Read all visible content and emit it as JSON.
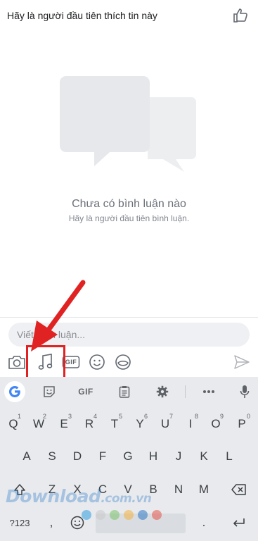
{
  "header": {
    "text": "Hãy là người đầu tiên thích tin này"
  },
  "empty_state": {
    "title": "Chưa có bình luận nào",
    "subtitle": "Hãy là người đầu tiên bình luận."
  },
  "comment": {
    "placeholder": "Viết bình luận..."
  },
  "tools": [
    "camera-icon",
    "music-note-icon",
    "gif-icon",
    "emoji-icon",
    "sticker-icon",
    "send-icon"
  ],
  "gif_label": "GIF",
  "keyboard": {
    "toolbar_gif": "GIF",
    "row1": [
      {
        "k": "Q",
        "h": "1"
      },
      {
        "k": "W",
        "h": "2"
      },
      {
        "k": "E",
        "h": "3"
      },
      {
        "k": "R",
        "h": "4"
      },
      {
        "k": "T",
        "h": "5"
      },
      {
        "k": "Y",
        "h": "6"
      },
      {
        "k": "U",
        "h": "7"
      },
      {
        "k": "I",
        "h": "8"
      },
      {
        "k": "O",
        "h": "9"
      },
      {
        "k": "P",
        "h": "0"
      }
    ],
    "row2": [
      "A",
      "S",
      "D",
      "F",
      "G",
      "H",
      "J",
      "K",
      "L"
    ],
    "row3": [
      "Z",
      "X",
      "C",
      "V",
      "B",
      "N",
      "M"
    ],
    "sym_label": "?123",
    "comma": ",",
    "period": "."
  },
  "watermark": {
    "main": "Download",
    "suffix": ".com.vn",
    "dot_colors": [
      "#2f9de0",
      "#c9c9c9",
      "#7ac36a",
      "#f3b340",
      "#2b78c2",
      "#e5534b"
    ]
  },
  "colors": {
    "accent": "#e02222",
    "keyboard_bg": "#e8eaed"
  }
}
